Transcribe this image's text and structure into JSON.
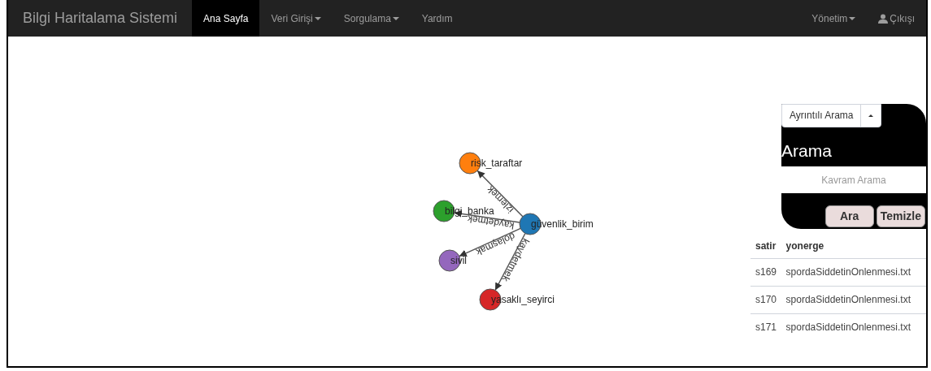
{
  "navbar": {
    "brand": "Bilgi Haritalama Sistemi",
    "items": [
      {
        "label": "Ana Sayfa",
        "selected": true,
        "dropdown": false
      },
      {
        "label": "Veri Girişi",
        "selected": false,
        "dropdown": true
      },
      {
        "label": "Sorgulama",
        "selected": false,
        "dropdown": true
      },
      {
        "label": "Yardım",
        "selected": false,
        "dropdown": false
      }
    ],
    "right_items": [
      {
        "label": "Yönetim",
        "kind": "dropdown"
      },
      {
        "label": "Çıkışı",
        "kind": "user"
      }
    ]
  },
  "graph": {
    "nodes": [
      {
        "label": "risk_taraftar",
        "color": "#ff7f0e"
      },
      {
        "label": "bilgi_banka",
        "color": "#2ca02c"
      },
      {
        "label": "güvenlik_birim",
        "color": "#1f77b4"
      },
      {
        "label": "sivil",
        "color": "#9467bd"
      },
      {
        "label": "yasaklı_seyirci",
        "color": "#d62728"
      }
    ],
    "edges": [
      {
        "label": "izlemek"
      },
      {
        "label": "kaydetmek"
      },
      {
        "label": "dolaşmak"
      },
      {
        "label": "kaydetmek"
      }
    ]
  },
  "search_panel": {
    "mode_dropdown": "Ayrıntılı Arama",
    "title": "Arama",
    "search": {
      "placeholder": "Kavram Arama"
    },
    "buttons": [
      "Ara",
      "Temizle"
    ]
  },
  "table": {
    "columns": [
      "satir",
      "yonerge"
    ],
    "rows": [
      [
        "s169",
        "spordaSiddetinOnlenmesi.txt"
      ],
      [
        "s170",
        "spordaSiddetinOnlenmesi.txt"
      ],
      [
        "s171",
        "spordaSiddetinOnlenmesi.txt"
      ]
    ]
  }
}
